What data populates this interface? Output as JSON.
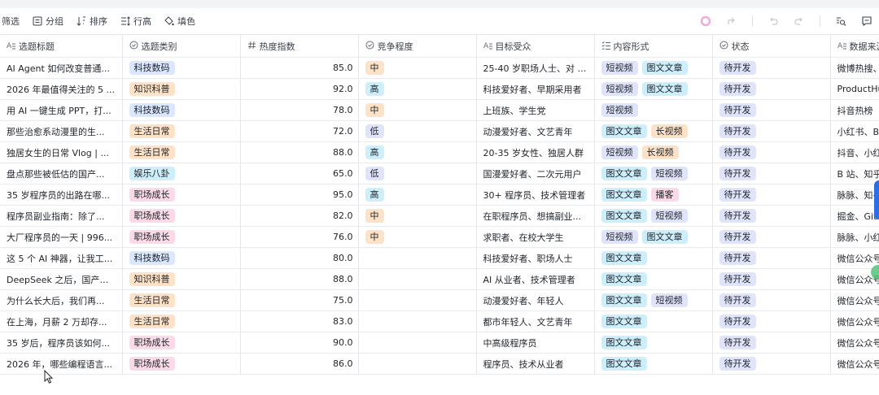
{
  "toolbar": {
    "left": [
      {
        "label": "筛选",
        "icon": "filter-icon"
      },
      {
        "label": "分组",
        "icon": "group-icon"
      },
      {
        "label": "排序",
        "icon": "sort-icon"
      },
      {
        "label": "行高",
        "icon": "row-height-icon"
      },
      {
        "label": "填色",
        "icon": "fill-color-icon"
      }
    ],
    "right": [
      "loading-icon",
      "share-icon",
      "undo-icon",
      "redo-icon",
      "search-icon",
      "comment-icon"
    ]
  },
  "columns": [
    {
      "label": "选题标题",
      "icon": "text-field-icon"
    },
    {
      "label": "选题类别",
      "icon": "single-select-icon"
    },
    {
      "label": "热度指数",
      "icon": "number-field-icon"
    },
    {
      "label": "竞争程度",
      "icon": "single-select-icon"
    },
    {
      "label": "目标受众",
      "icon": "text-field-icon"
    },
    {
      "label": "内容形式",
      "icon": "multi-select-icon"
    },
    {
      "label": "状态",
      "icon": "single-select-icon"
    },
    {
      "label": "数据来源",
      "icon": "text-field-icon"
    }
  ],
  "colors": {
    "科技数码": "t-blue",
    "知识科普": "t-orange",
    "生活日常": "t-orange",
    "娱乐八卦": "t-cyan",
    "职场成长": "t-pink",
    "中": "t-orange",
    "高": "t-cyan",
    "低": "t-indigo",
    "短视频": "t-indigo",
    "图文文章": "t-cyan",
    "长视频": "t-orange",
    "播客": "t-pink",
    "待开发": "t-status"
  },
  "rows": [
    {
      "title": "AI Agent 如何改变普通...",
      "category": "科技数码",
      "heat": "85.0",
      "competition": "中",
      "audience": "25-40 岁职场人士、对 A...",
      "formats": [
        "短视频",
        "图文文章"
      ],
      "status": "待开发",
      "source": "微博热搜、"
    },
    {
      "title": "2026 年最值得关注的 5 ...",
      "category": "知识科普",
      "heat": "92.0",
      "competition": "高",
      "audience": "科技爱好者、早期采用者",
      "formats": [
        "短视频",
        "图文文章"
      ],
      "status": "待开发",
      "source": "ProductHun"
    },
    {
      "title": "用 AI 一键生成 PPT，打...",
      "category": "科技数码",
      "heat": "78.0",
      "competition": "中",
      "audience": "上班族、学生党",
      "formats": [
        "短视频"
      ],
      "status": "待开发",
      "source": "抖音热榜"
    },
    {
      "title": "那些治愈系动漫里的生...",
      "category": "生活日常",
      "heat": "72.0",
      "competition": "低",
      "audience": "动漫爱好者、文艺青年",
      "formats": [
        "图文文章",
        "长视频"
      ],
      "status": "待开发",
      "source": "小红书、B"
    },
    {
      "title": "独居女生的日常 Vlog | ...",
      "category": "生活日常",
      "heat": "88.0",
      "competition": "高",
      "audience": "20-35 岁女性、独居人群",
      "formats": [
        "短视频",
        "长视频"
      ],
      "status": "待开发",
      "source": "抖音、小红"
    },
    {
      "title": "盘点那些被低估的国产...",
      "category": "娱乐八卦",
      "heat": "65.0",
      "competition": "低",
      "audience": "国漫爱好者、二次元用户",
      "formats": [
        "图文文章",
        "短视频"
      ],
      "status": "待开发",
      "source": "B 站、知乎"
    },
    {
      "title": "35 岁程序员的出路在哪...",
      "category": "职场成长",
      "heat": "95.0",
      "competition": "高",
      "audience": "30+ 程序员、技术管理者",
      "formats": [
        "图文文章",
        "播客"
      ],
      "status": "待开发",
      "source": "脉脉、知乎"
    },
    {
      "title": "程序员副业指南：除了...",
      "category": "职场成长",
      "heat": "82.0",
      "competition": "中",
      "audience": "在职程序员、想搞副业...",
      "formats": [
        "图文文章",
        "短视频"
      ],
      "status": "待开发",
      "source": "掘金、Gith"
    },
    {
      "title": "大厂程序员的一天 | 996...",
      "category": "职场成长",
      "heat": "76.0",
      "competition": "中",
      "audience": "求职者、在校大学生",
      "formats": [
        "短视频",
        "图文文章"
      ],
      "status": "待开发",
      "source": "脉脉、小红"
    },
    {
      "title": "这 5 个 AI 神器，让我工...",
      "category": "科技数码",
      "heat": "80.0",
      "competition": "",
      "audience": "科技爱好者、职场人士",
      "formats": [
        "图文文章"
      ],
      "status": "待开发",
      "source": "微信公众号"
    },
    {
      "title": "DeepSeek 之后，国产大...",
      "category": "知识科普",
      "heat": "88.0",
      "competition": "",
      "audience": "AI 从业者、技术管理者",
      "formats": [
        "图文文章"
      ],
      "status": "待开发",
      "source": "微信公众号"
    },
    {
      "title": "为什么长大后，我们再...",
      "category": "生活日常",
      "heat": "75.0",
      "competition": "",
      "audience": "动漫爱好者、年轻人",
      "formats": [
        "图文文章",
        "短视频"
      ],
      "status": "待开发",
      "source": "微信公众号"
    },
    {
      "title": "在上海，月薪 2 万却存...",
      "category": "生活日常",
      "heat": "83.0",
      "competition": "",
      "audience": "都市年轻人、文艺青年",
      "formats": [
        "图文文章"
      ],
      "status": "待开发",
      "source": "微信公众号"
    },
    {
      "title": "35 岁后，程序员该如何...",
      "category": "职场成长",
      "heat": "90.0",
      "competition": "",
      "audience": "中高级程序员",
      "formats": [
        "图文文章"
      ],
      "status": "待开发",
      "source": "微信公众号"
    },
    {
      "title": "2026 年，哪些编程语言...",
      "category": "职场成长",
      "heat": "86.0",
      "competition": "",
      "audience": "程序员、技术从业者",
      "formats": [
        "图文文章"
      ],
      "status": "待开发",
      "source": "微信公众号"
    }
  ]
}
